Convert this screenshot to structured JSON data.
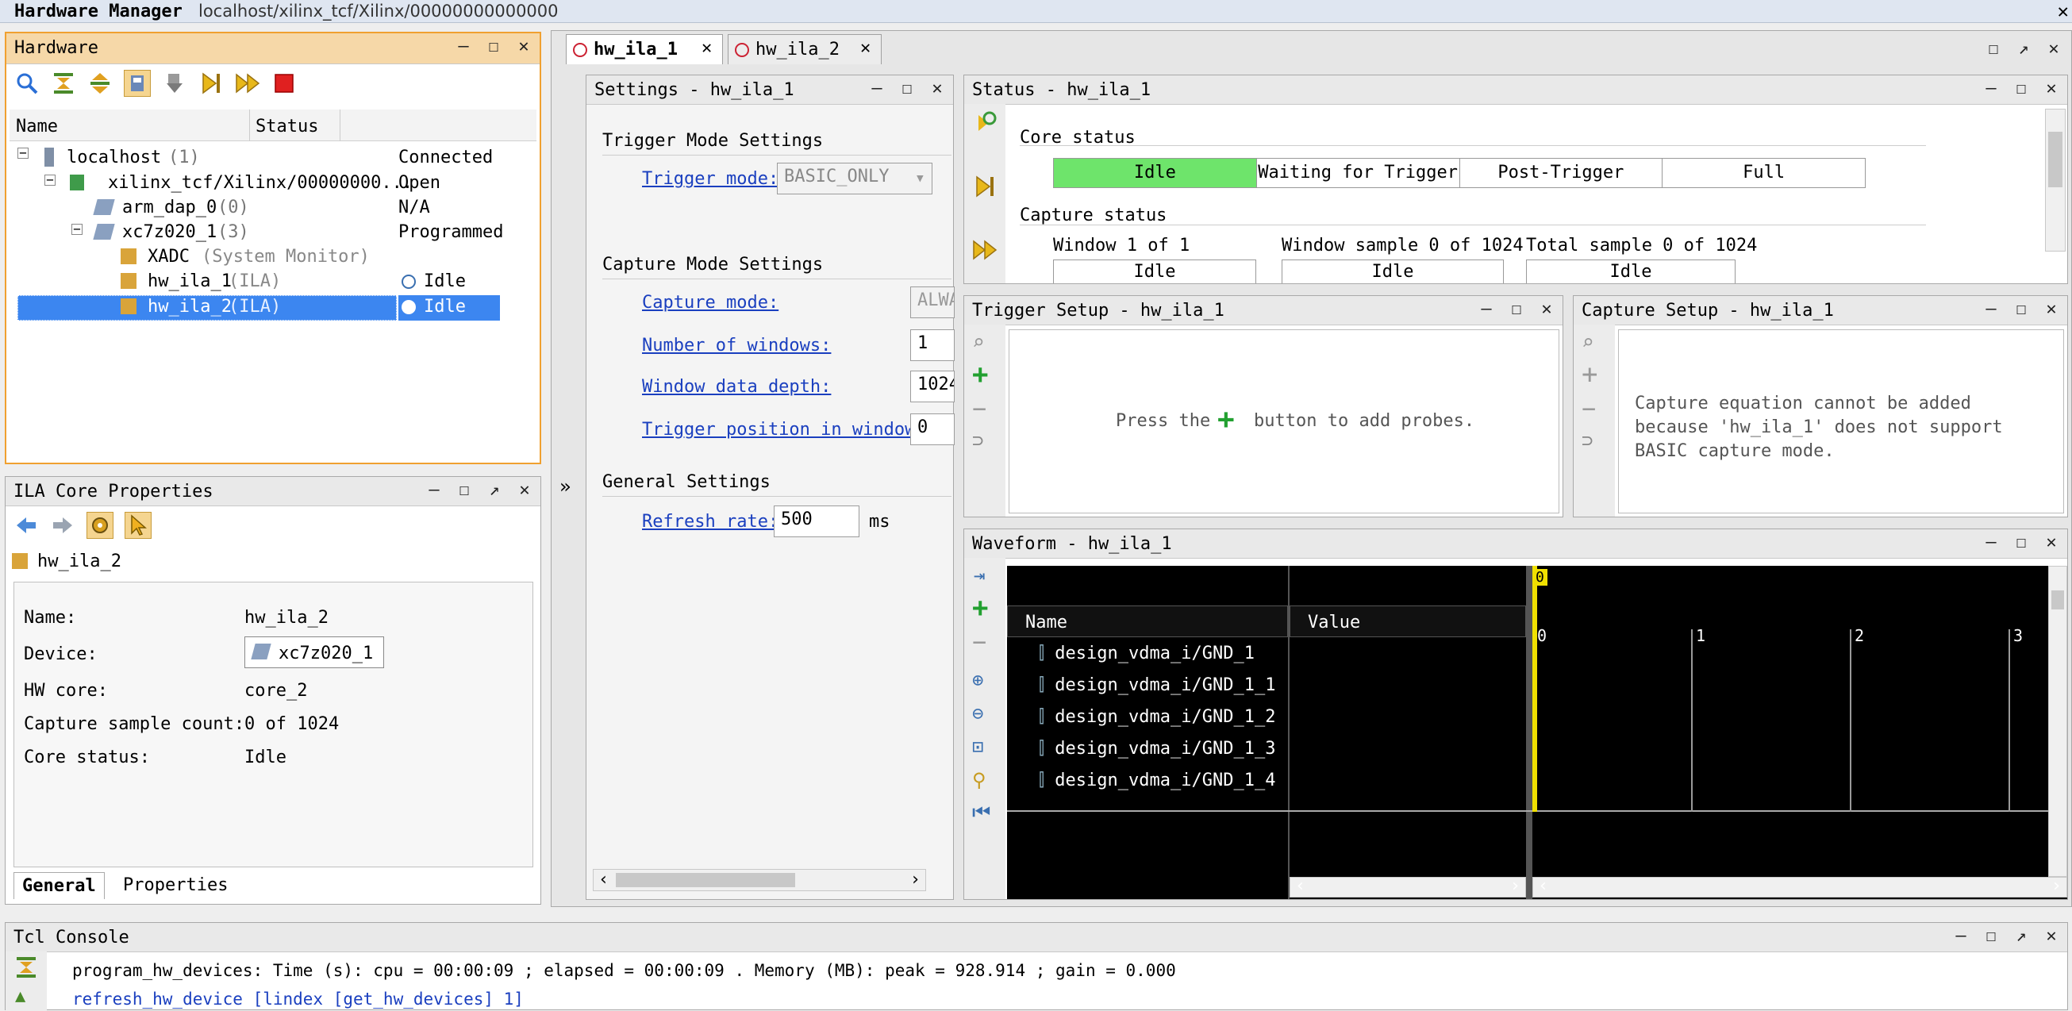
{
  "window": {
    "title": "Hardware Manager",
    "path": "localhost/xilinx_tcf/Xilinx/00000000000000"
  },
  "hardware": {
    "title": "Hardware",
    "col_name": "Name",
    "col_status": "Status",
    "rows": [
      {
        "name": "localhost",
        "extra": "(1)",
        "status": "Connected"
      },
      {
        "name": "xilinx_tcf/Xilinx/00000000...",
        "extra": "",
        "status": "Open"
      },
      {
        "name": "arm_dap_0",
        "extra": "(0)",
        "status": "N/A"
      },
      {
        "name": "xc7z020_1",
        "extra": "(3)",
        "status": "Programmed"
      },
      {
        "name": "XADC",
        "extra": "(System Monitor)",
        "status": ""
      },
      {
        "name": "hw_ila_1",
        "extra": "(ILA)",
        "status": "Idle"
      },
      {
        "name": "hw_ila_2",
        "extra": "(ILA)",
        "status": "Idle"
      }
    ]
  },
  "ila_props": {
    "title": "ILA Core Properties",
    "object": "hw_ila_2",
    "fields": [
      {
        "label": "Name:",
        "value": "hw_ila_2"
      },
      {
        "label": "Device:",
        "value": "xc7z020_1"
      },
      {
        "label": "HW core:",
        "value": "core_2"
      },
      {
        "label": "Capture sample count:",
        "value": "0 of 1024"
      },
      {
        "label": "Core status:",
        "value": "Idle"
      }
    ],
    "tabs": [
      "General",
      "Properties"
    ]
  },
  "tabs": [
    {
      "label": "hw_ila_1"
    },
    {
      "label": "hw_ila_2"
    }
  ],
  "settings": {
    "title": "Settings - hw_ila_1",
    "trigger_section": "Trigger Mode Settings",
    "trigger_mode_label": "Trigger mode:",
    "trigger_mode_value": "BASIC_ONLY",
    "capture_section": "Capture Mode Settings",
    "capture_mode_label": "Capture mode:",
    "capture_mode_value": "ALWA",
    "windows_label": "Number of windows:",
    "windows_value": "1",
    "depth_label": "Window data depth:",
    "depth_value": "1024",
    "trigpos_label": "Trigger position in window:",
    "trigpos_value": "0",
    "general_section": "General Settings",
    "refresh_label": "Refresh rate:",
    "refresh_value": "500",
    "refresh_unit": "ms"
  },
  "status": {
    "title": "Status - hw_ila_1",
    "core_status": "Core status",
    "states": [
      "Idle",
      "Waiting for Trigger",
      "Post-Trigger",
      "Full"
    ],
    "capture_status": "Capture status",
    "window": "Window 1 of 1",
    "window_sample": "Window sample 0 of 1024",
    "total_sample": "Total sample 0 of 1024",
    "cells": [
      "Idle",
      "Idle",
      "Idle"
    ]
  },
  "trigger": {
    "title": "Trigger Setup - hw_ila_1",
    "msg_pre": "Press the",
    "msg_post": "button to add probes."
  },
  "capture": {
    "title": "Capture Setup - hw_ila_1",
    "msg1": "Capture equation cannot be added",
    "msg2": "because 'hw_ila_1' does not support",
    "msg3": "BASIC capture mode."
  },
  "waveform": {
    "title": "Waveform - hw_ila_1",
    "col_name": "Name",
    "col_value": "Value",
    "marker": "0",
    "ticks": [
      "0",
      "1",
      "2",
      "3"
    ],
    "signals": [
      "design_vdma_i/GND_1",
      "design_vdma_i/GND_1_1",
      "design_vdma_i/GND_1_2",
      "design_vdma_i/GND_1_3",
      "design_vdma_i/GND_1_4"
    ]
  },
  "tcl": {
    "title": "Tcl Console",
    "lines": [
      "program_hw_devices: Time (s): cpu = 00:00:09 ; elapsed = 00:00:09 . Memory (MB): peak = 928.914 ; gain = 0.000",
      "refresh_hw_device [lindex [get_hw_devices] 1]"
    ]
  },
  "colors": {
    "idle_green": "#6ee46b",
    "selection": "#3c86f0",
    "link": "#1a3fbf",
    "orange_header": "#f6d8a8"
  }
}
